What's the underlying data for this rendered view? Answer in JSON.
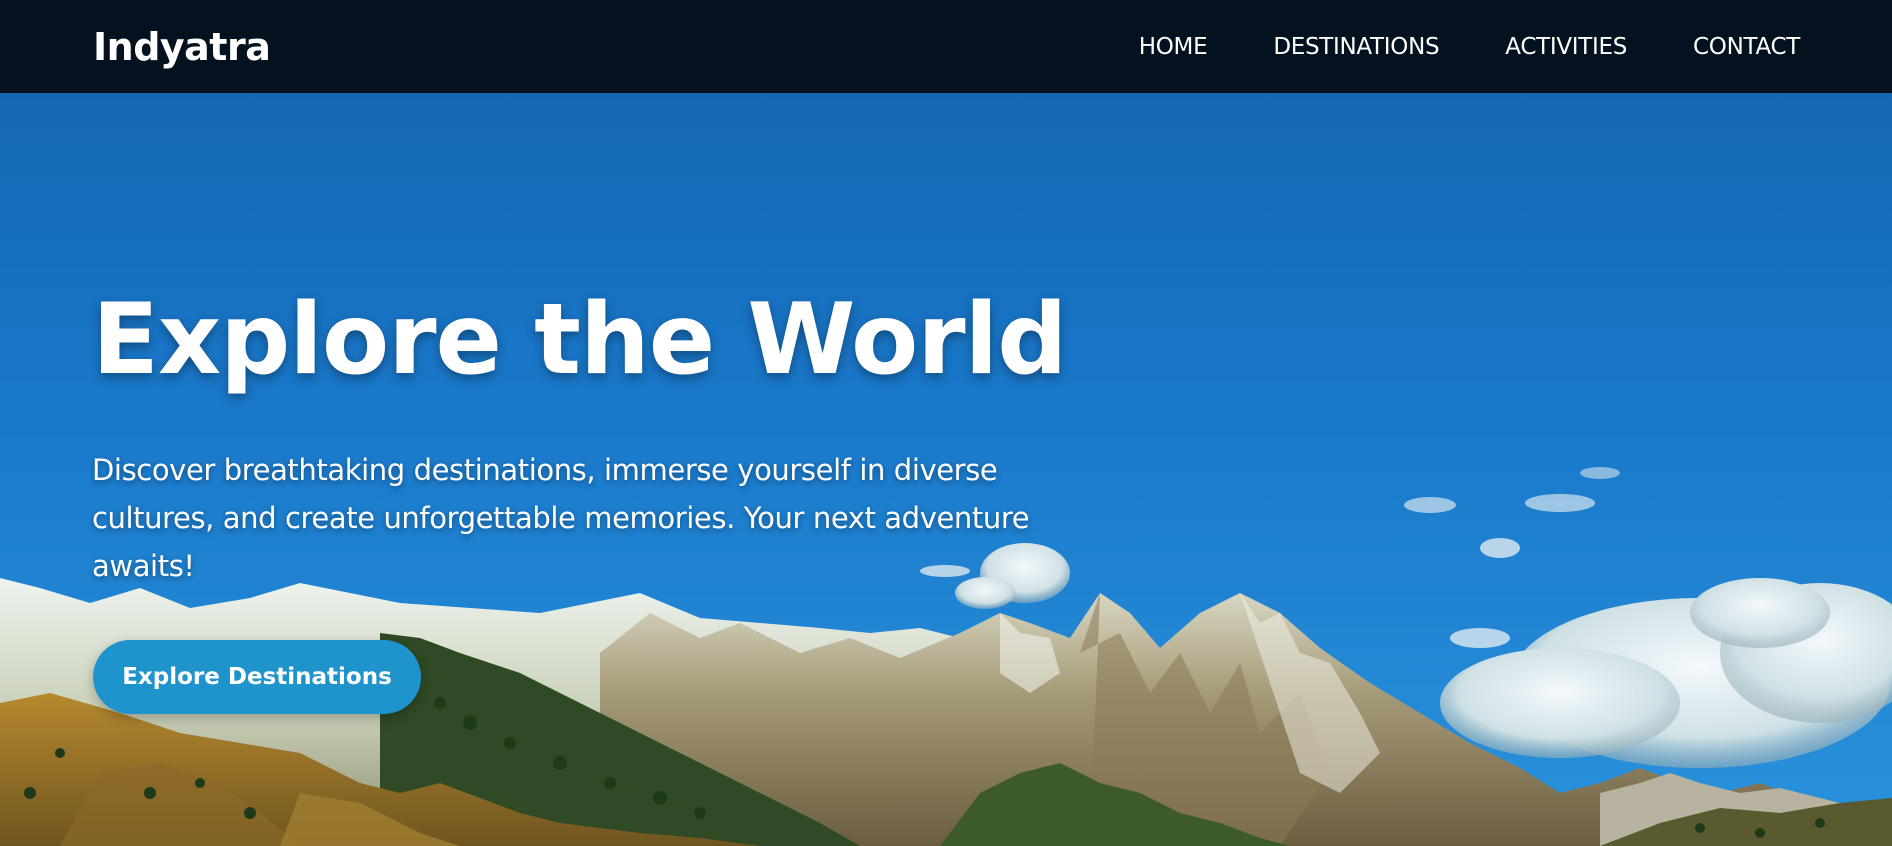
{
  "navbar": {
    "logo": "Indyatra",
    "links": [
      "HOME",
      "DESTINATIONS",
      "ACTIVITIES",
      "CONTACT"
    ]
  },
  "hero": {
    "title": "Explore the World",
    "subtitle": "Discover breathtaking destinations, immerse yourself in diverse cultures, and create unforgettable memories. Your next adventure awaits!",
    "cta_label": "Explore Destinations",
    "background_image": "mountain-landscape-photo"
  },
  "colors": {
    "navbar_bg": "#04121f",
    "sky": "#1a78c8",
    "button": "#1f93cc",
    "text": "#ffffff"
  }
}
